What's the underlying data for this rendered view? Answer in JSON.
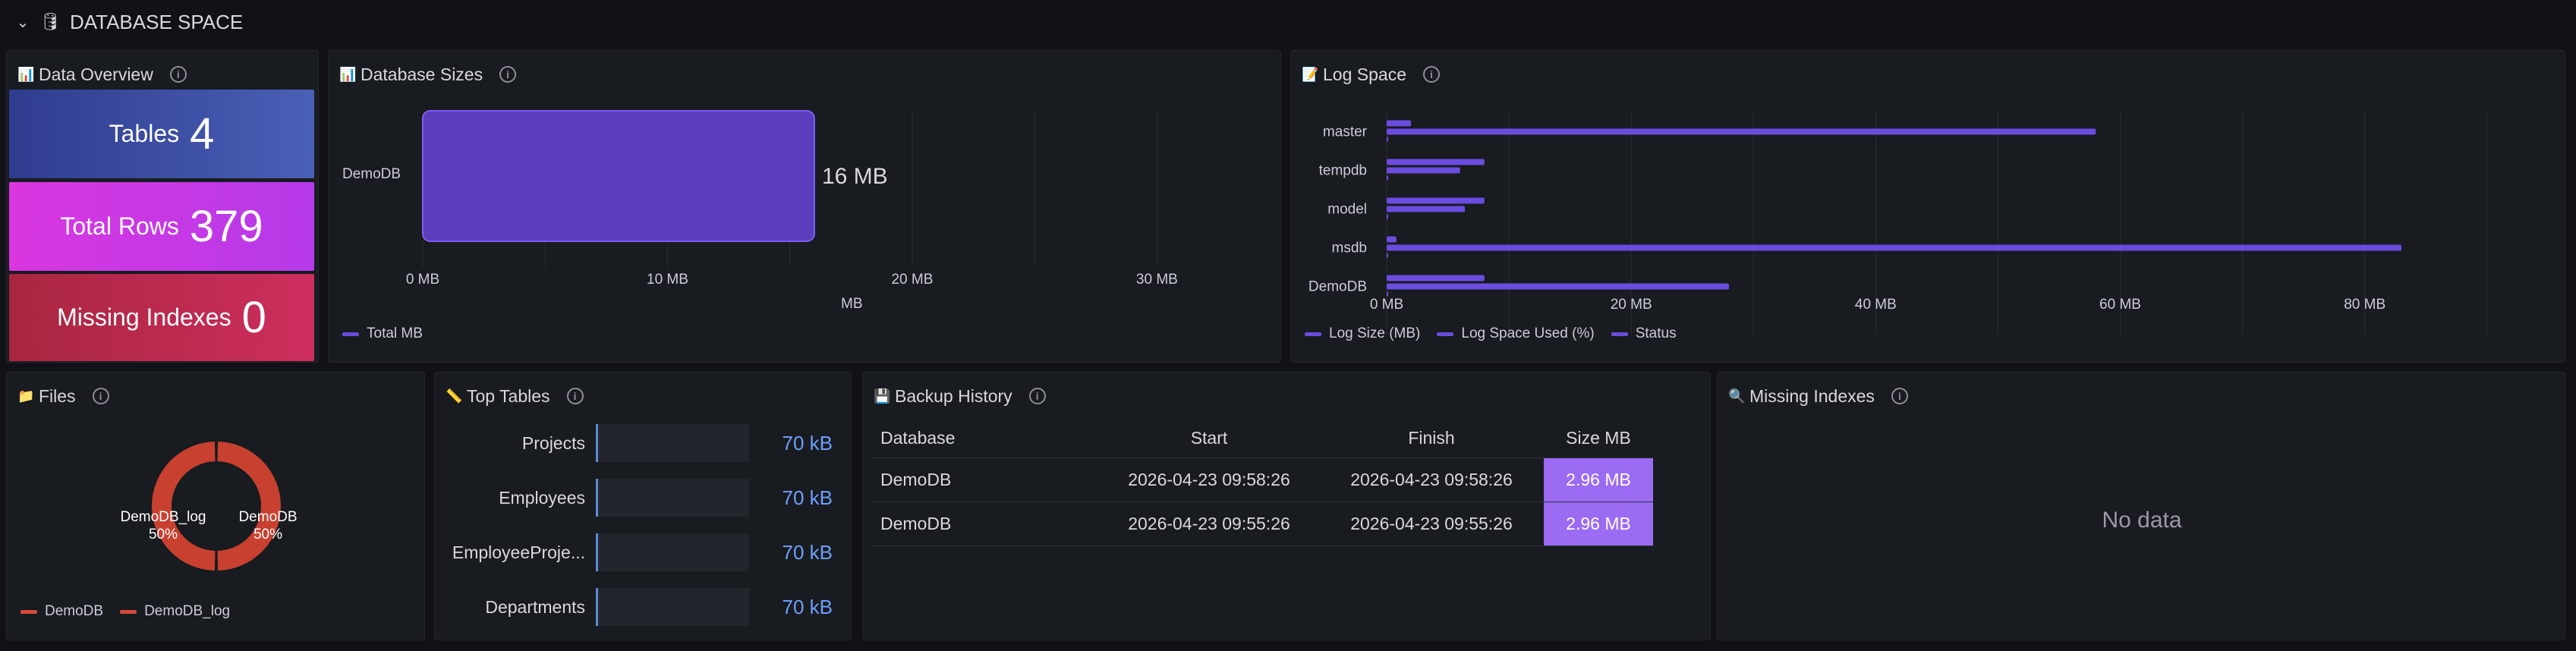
{
  "row": {
    "title": "DATABASE SPACE",
    "emoji": "🛢"
  },
  "colors": {
    "tables_bg": "#3f4fa8",
    "rows_bg": "#c736e3",
    "missing_bg": "#c42a52",
    "bar_purple": "#6a4cdf",
    "files_red": "#d44a3a",
    "cell_purple": "#9b6bf3",
    "blue_value": "#6e9fff"
  },
  "overview": {
    "title": "Data Overview",
    "emoji": "📊",
    "stats": [
      {
        "label": "Tables",
        "value": "4"
      },
      {
        "label": "Total Rows",
        "value": "379"
      },
      {
        "label": "Missing Indexes",
        "value": "0"
      }
    ]
  },
  "db_sizes": {
    "title": "Database Sizes",
    "emoji": "📊",
    "legend": "Total MB",
    "value_label": "16 MB"
  },
  "log_space": {
    "title": "Log Space",
    "emoji": "📝",
    "legend": [
      "Log Size (MB)",
      "Log Space Used (%)",
      "Status"
    ]
  },
  "files": {
    "title": "Files",
    "emoji": "📁",
    "slices": [
      {
        "name": "DemoDB_log",
        "pct": "50%"
      },
      {
        "name": "DemoDB",
        "pct": "50%"
      }
    ],
    "legend": [
      "DemoDB",
      "DemoDB_log"
    ]
  },
  "top_tables": {
    "title": "Top Tables",
    "emoji": "📏",
    "rows": [
      {
        "name": "Projects",
        "value": "70 kB"
      },
      {
        "name": "Employees",
        "value": "70 kB"
      },
      {
        "name": "EmployeeProje...",
        "value": "70 kB"
      },
      {
        "name": "Departments",
        "value": "70 kB"
      }
    ]
  },
  "backup": {
    "title": "Backup History",
    "emoji": "💾",
    "headers": [
      "Database",
      "Start",
      "Finish",
      "Size MB"
    ],
    "rows": [
      [
        "DemoDB",
        "2026-04-23 09:58:26",
        "2026-04-23 09:58:26",
        "2.96 MB"
      ],
      [
        "DemoDB",
        "2026-04-23 09:55:26",
        "2026-04-23 09:55:26",
        "2.96 MB"
      ]
    ]
  },
  "missing_indexes": {
    "title": "Missing Indexes",
    "emoji": "🔍",
    "empty_text": "No data"
  },
  "chart_data": [
    {
      "type": "bar",
      "orientation": "horizontal",
      "categories": [
        "DemoDB"
      ],
      "series": [
        {
          "name": "Total MB",
          "values": [
            16
          ]
        }
      ],
      "xlabel": "MB",
      "xticks": [
        "0 MB",
        "10 MB",
        "20 MB",
        "30 MB"
      ],
      "xlim": [
        0,
        32.5
      ]
    },
    {
      "type": "bar",
      "orientation": "horizontal",
      "categories": [
        "master",
        "tempdb",
        "model",
        "msdb",
        "DemoDB"
      ],
      "series": [
        {
          "name": "Log Size (MB)",
          "values": [
            2,
            8,
            8,
            0.8,
            8
          ]
        },
        {
          "name": "Log Space Used (%)",
          "values": [
            58,
            6,
            6.4,
            83,
            28
          ]
        },
        {
          "name": "Status",
          "values": [
            0,
            0,
            0,
            0,
            0
          ]
        }
      ],
      "xticks": [
        "0 MB",
        "20 MB",
        "40 MB",
        "60 MB",
        "80 MB"
      ],
      "xlim": [
        0,
        92
      ]
    },
    {
      "type": "pie",
      "style": "donut",
      "labels": [
        "DemoDB",
        "DemoDB_log"
      ],
      "values": [
        50,
        50
      ]
    }
  ]
}
